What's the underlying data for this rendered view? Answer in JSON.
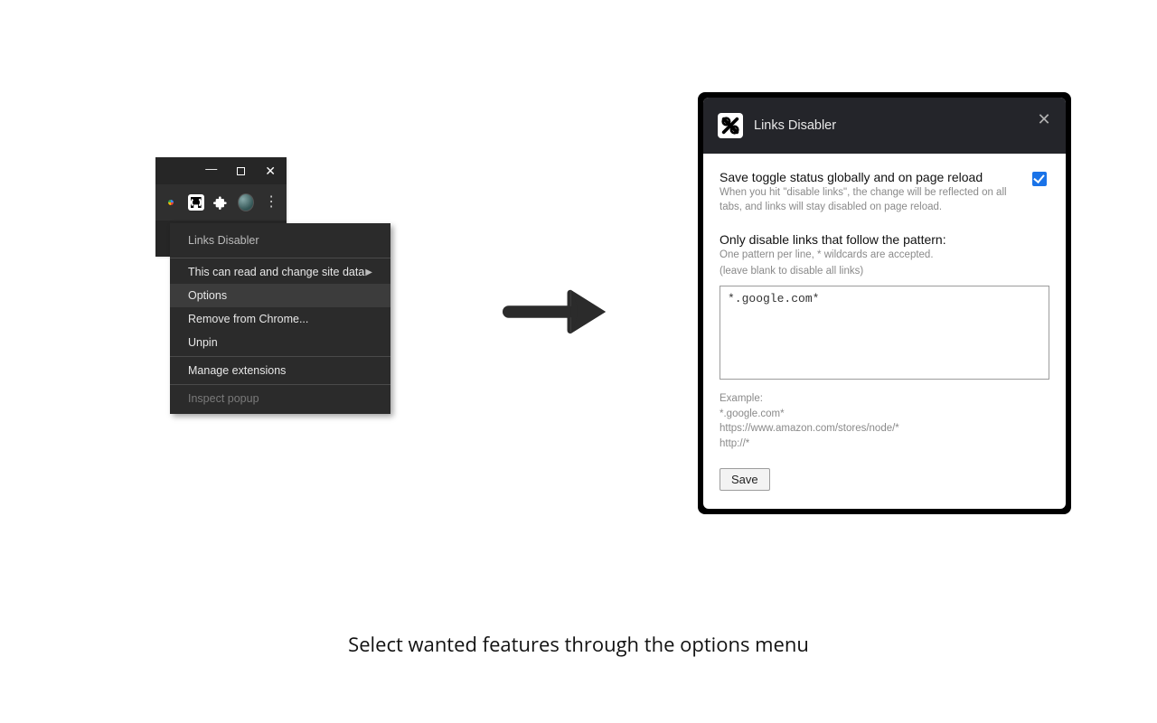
{
  "context_menu": {
    "header": "Links Disabler",
    "items": [
      {
        "label": "This can read and change site data",
        "has_submenu": true
      },
      {
        "label": "Options",
        "highlight": true
      },
      {
        "label": "Remove from Chrome..."
      },
      {
        "label": "Unpin"
      }
    ],
    "manage": "Manage extensions",
    "inspect": "Inspect popup"
  },
  "dialog": {
    "title": "Links Disabler",
    "save_toggle": {
      "title": "Save toggle status globally and on page reload",
      "sub": "When you hit \"disable links\", the change will be reflected on all tabs, and links will stay disabled on page reload.",
      "checked": true
    },
    "patterns": {
      "title": "Only disable links that follow the pattern:",
      "sub1": "One pattern per line, * wildcards are accepted.",
      "sub2": "(leave blank to disable all links)",
      "value": "*.google.com*",
      "example_label": "Example:",
      "ex1": "*.google.com*",
      "ex2": "https://www.amazon.com/stores/node/*",
      "ex3": "http://*"
    },
    "save_button": "Save"
  },
  "caption": "Select wanted features through the options menu"
}
